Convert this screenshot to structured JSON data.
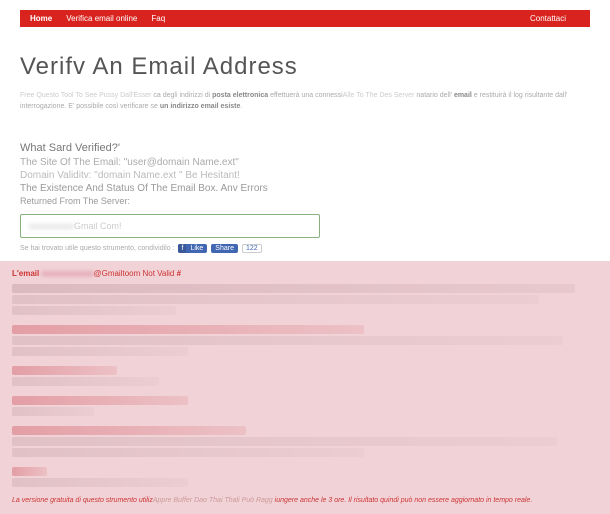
{
  "nav": {
    "home": "Home",
    "verify": "Verifica email online",
    "faq": "Faq",
    "contact": "Contattaci"
  },
  "title": "Verifv An Email Address",
  "intro": {
    "pre": "Free Questo Tool To See Pussy Dall'Esser ",
    "mid1": "ca degli indirizzi di ",
    "b1": "posta elettronica",
    "mid2": " effettuerà una connessi",
    "link2": "Alle To The Des Server ",
    "mid3": "natario dell' ",
    "b2": "email",
    "mid4": " e restituirà il log risultante dall' interrogazione. E' possibile così verificare se ",
    "b3": "un indirizzo email esiste",
    "end": "."
  },
  "sectionQ": "What Sard Verified?'",
  "line1": "The Site Of The Email: \"user@domain Name.ext\"",
  "line2": "Domain Validitv: \"domain Name.ext \" Be Hesitant!",
  "line3": "The Existence And Status Of The Email Box. Anv Errors",
  "line4": "Returned From The Server:",
  "input_blur": "xxxxxxxxxx",
  "input_suffix": "Gmail Com!",
  "share_text": "Se hai trovato utile questo strumento, condividilo :",
  "fb_like": "Like",
  "fb_share": "Share",
  "fb_count": "122",
  "result": {
    "prefix": "L'email ",
    "blurred": "xxxxxxxxxxxxx",
    "suffix": "@Gmailtoom Not Valid ",
    "mark": "#"
  },
  "footnote": {
    "t1": "La versione gratuita di questo strumento utiliz",
    "link": "Appre Buffer Dao Thai Thali Può Ragg",
    "t2": " iungere anche le 3 ore. Il risultato quindi può non essere aggiornato in tempo reale."
  }
}
